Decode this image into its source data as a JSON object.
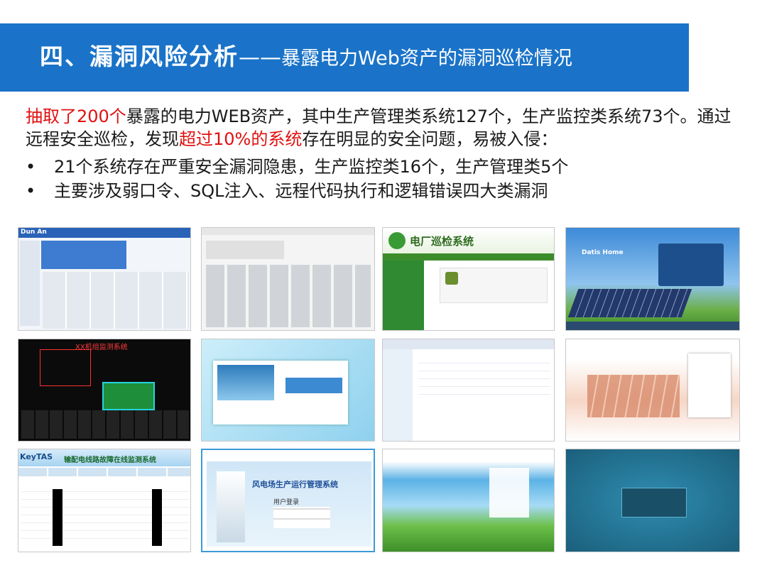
{
  "header": {
    "title_main": "四、漏洞风险分析",
    "title_dash": "——",
    "title_sub": "暴露电力Web资产的漏洞巡检情况"
  },
  "intro": {
    "part1_red": "抽取了200个",
    "part2": "暴露的电力WEB资产，其中生产管理类系统127个，生产监控类系统73个。通过远程安全巡检，发现",
    "part3_red": "超过10%的系统",
    "part4": "存在明显的安全问题，易被入侵："
  },
  "bullets": [
    {
      "dot": "•",
      "text": "21个系统存在严重安全漏洞隐患，生产监控类16个，生产管理类5个"
    },
    {
      "dot": "•",
      "text": "主要涉及弱口令、SQL注入、远程代码执行和逻辑错误四大类漏洞"
    }
  ],
  "screens": {
    "s1_logo": "Dun An",
    "s3_title": "电厂巡检系统",
    "s4_title": "Datis Home",
    "s5_title": "XX机组监测系统",
    "s9_logo": "KeyTAS",
    "s9_title": "输配电线路故障在线监测系统",
    "s10_title": "风电场生产运行管理系统",
    "s10_login": "用户登录"
  },
  "colors": {
    "accent": "#1a73c8",
    "highlight": "#e01010"
  }
}
